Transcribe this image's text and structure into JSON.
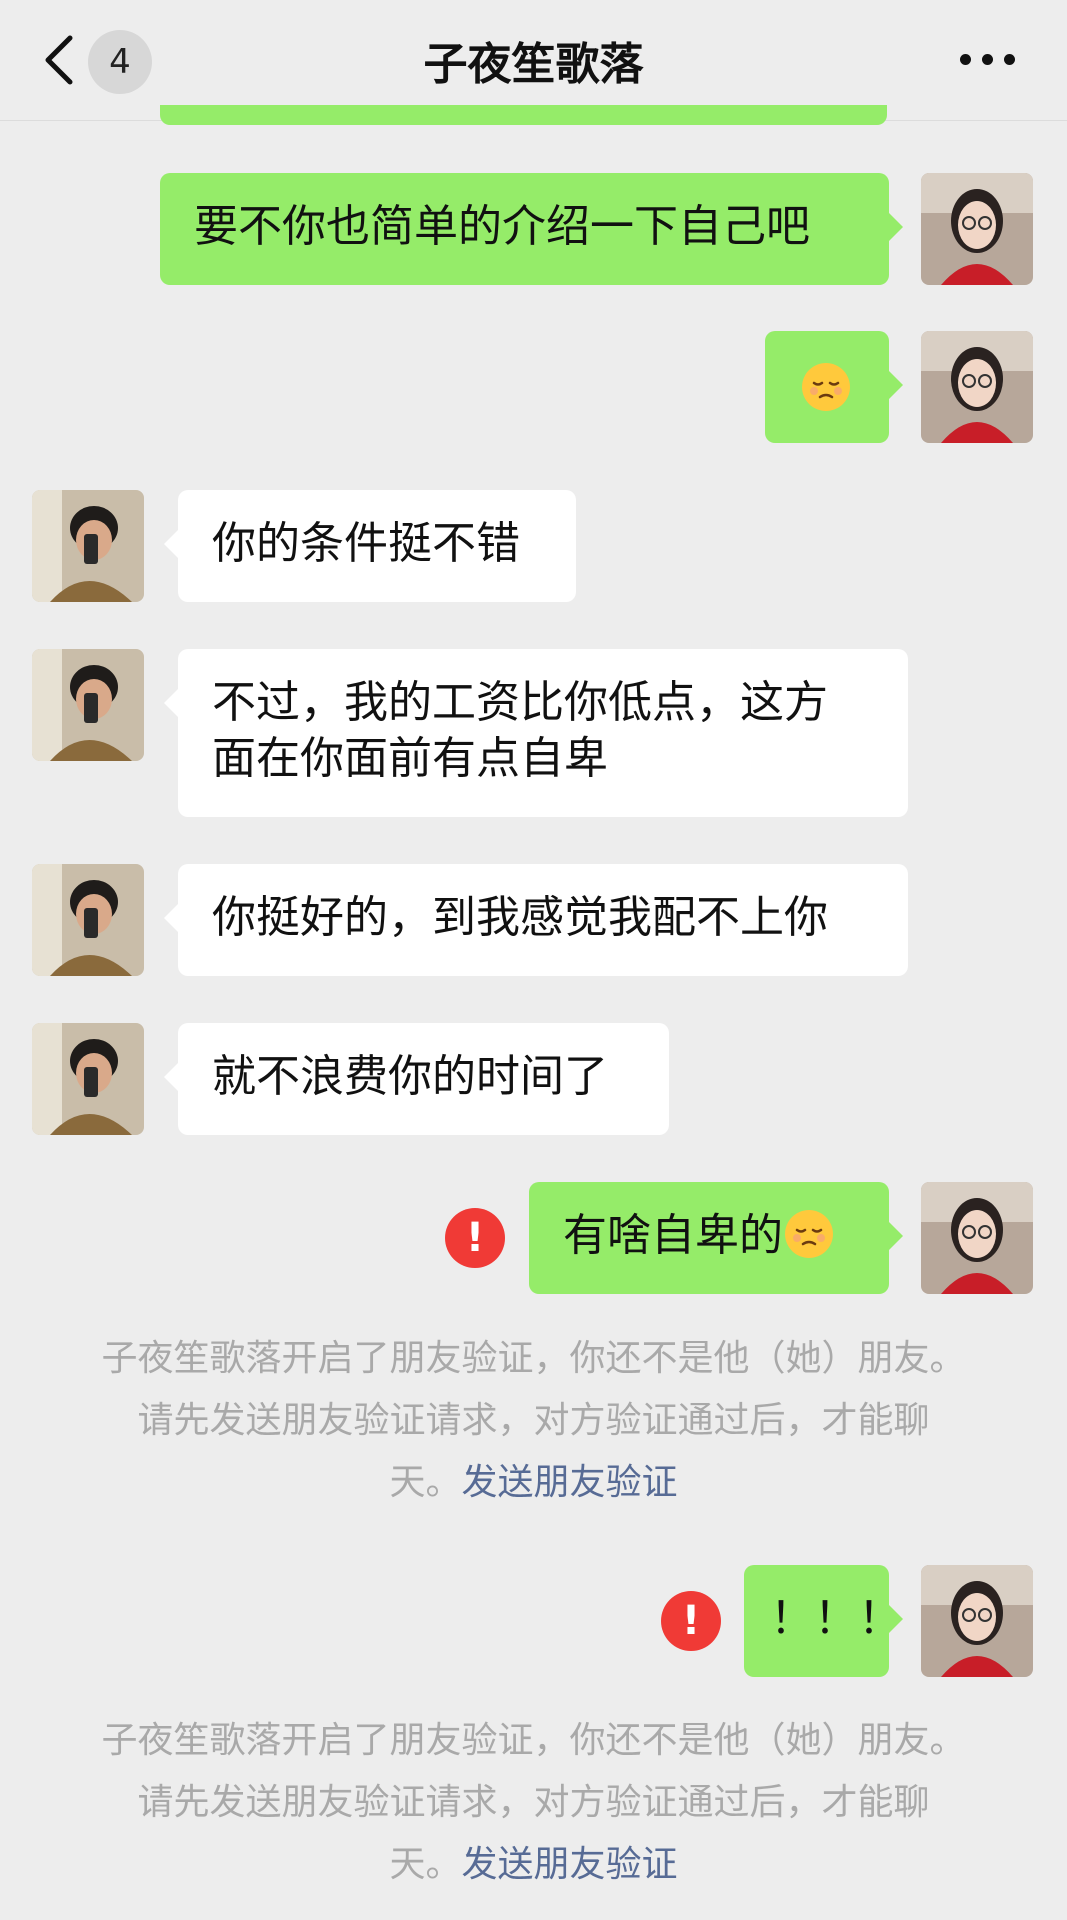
{
  "header": {
    "badge": "4",
    "title": "子夜笙歌落"
  },
  "messages": [
    {
      "side": "mine",
      "text": "要不你也简单的介绍一下自己吧"
    },
    {
      "side": "mine",
      "emoji": "pensive-face-icon"
    },
    {
      "side": "theirs",
      "text": "你的条件挺不错"
    },
    {
      "side": "theirs",
      "line1": "不过，我的工资比你低点，这方",
      "line2": "面在你面前有点自卑"
    },
    {
      "side": "theirs",
      "text": "你挺好的，到我感觉我配不上你"
    },
    {
      "side": "theirs",
      "text": "就不浪费你的时间了"
    },
    {
      "side": "mine",
      "text": "有啥自卑的",
      "emoji": "pensive-face-icon",
      "failed": true
    },
    {
      "side": "mine",
      "text": "！！！",
      "failed": true
    }
  ],
  "error_icon": "!",
  "system_notice": {
    "line1": "子夜笙歌落开启了朋友验证，你还不是他（她）朋友。",
    "line2": "请先发送朋友验证请求，对方验证通过后，才能聊",
    "line3_prefix": "天。",
    "link": "发送朋友验证"
  },
  "colors": {
    "my_bubble": "#95ec69",
    "their_bubble": "#ffffff",
    "background": "#ededed",
    "error": "#f03a36",
    "link": "#576b95"
  }
}
